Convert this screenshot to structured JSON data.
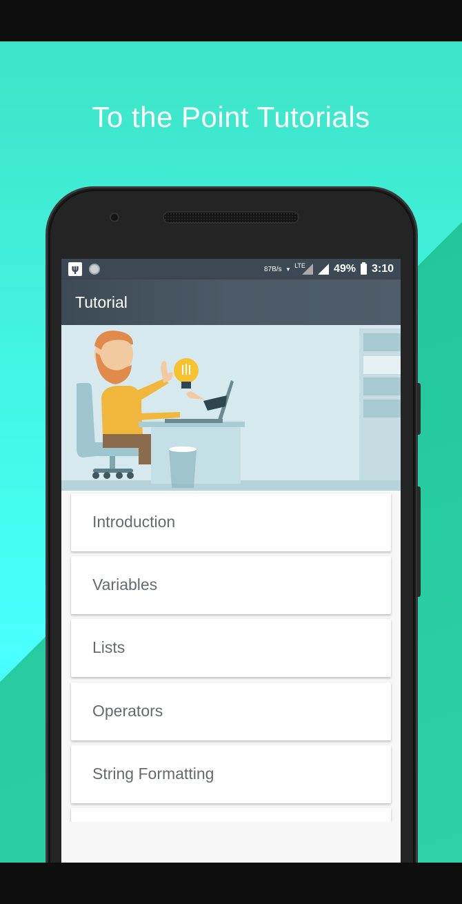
{
  "promo": {
    "title": "To the Point Tutorials"
  },
  "status_bar": {
    "net_speed": "87B/s",
    "network_type": "LTE",
    "battery": "49%",
    "time": "3:10",
    "icons": [
      "usb-icon",
      "notification-dot-icon",
      "download-arrow-icon",
      "signal-icon",
      "battery-icon"
    ]
  },
  "app_bar": {
    "title": "Tutorial"
  },
  "banner": {
    "illustration": "person-at-desk-with-lightbulb"
  },
  "topics": [
    {
      "label": "Introduction"
    },
    {
      "label": "Variables"
    },
    {
      "label": "Lists"
    },
    {
      "label": "Operators"
    },
    {
      "label": "String Formatting"
    },
    {
      "label": ""
    }
  ],
  "colors": {
    "accent": "#3fe0c5",
    "app_bar": "#3c4a55",
    "status_bar": "#3c4853",
    "card_text": "#666a6d"
  }
}
